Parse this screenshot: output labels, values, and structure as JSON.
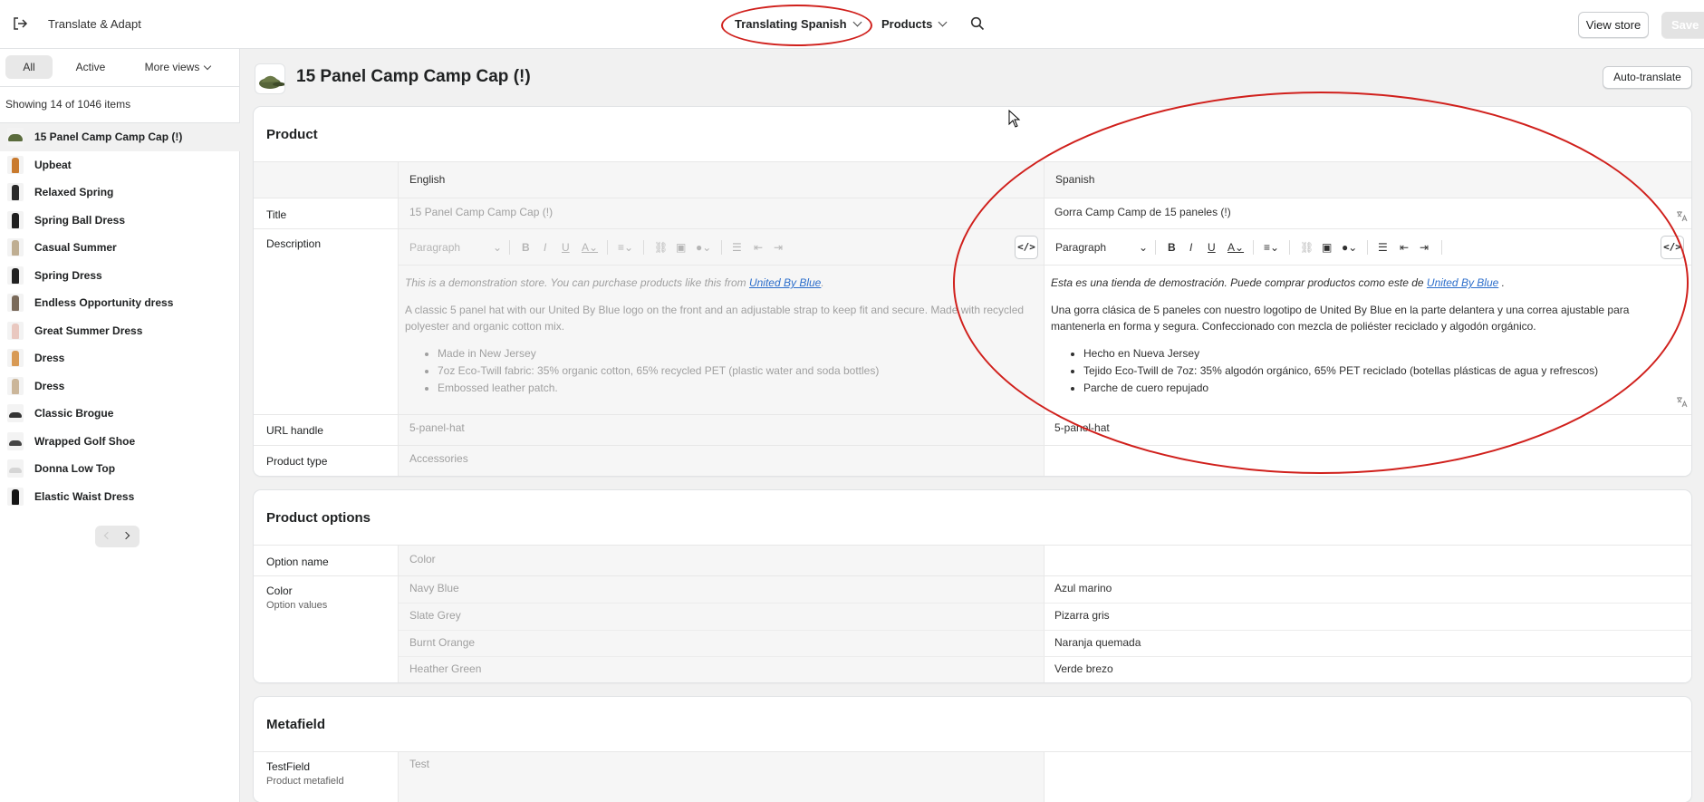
{
  "topbar": {
    "app_title": "Translate & Adapt",
    "language_selector": "Translating Spanish",
    "resource_selector": "Products",
    "view_store": "View store",
    "save": "Save"
  },
  "sidebar": {
    "tabs": [
      "All",
      "Active",
      "More views"
    ],
    "count_text": "Showing 14 of 1046 items",
    "items": [
      {
        "label": "15 Panel Camp Camp Cap (!)",
        "thumb_color": "#5a6b3c"
      },
      {
        "label": "Upbeat",
        "thumb_color": "#c97a2e"
      },
      {
        "label": "Relaxed Spring",
        "thumb_color": "#2a2a2a"
      },
      {
        "label": "Spring Ball Dress",
        "thumb_color": "#1f1f1f"
      },
      {
        "label": "Casual Summer",
        "thumb_color": "#bfae92"
      },
      {
        "label": "Spring Dress",
        "thumb_color": "#222222"
      },
      {
        "label": "Endless Opportunity dress",
        "thumb_color": "#7a6a5a"
      },
      {
        "label": "Great Summer Dress",
        "thumb_color": "#e9c8c0"
      },
      {
        "label": "Dress",
        "thumb_color": "#d89a55"
      },
      {
        "label": "Dress",
        "thumb_color": "#cbb69a"
      },
      {
        "label": "Classic Brogue",
        "thumb_color": "#333333"
      },
      {
        "label": "Wrapped Golf Shoe",
        "thumb_color": "#444444"
      },
      {
        "label": "Donna Low Top",
        "thumb_color": "#d5d5d5"
      },
      {
        "label": "Elastic Waist Dress",
        "thumb_color": "#151515"
      }
    ]
  },
  "main": {
    "product_title": "15 Panel Camp Camp Cap (!)",
    "auto_translate": "Auto-translate",
    "product_card": {
      "title": "Product",
      "col_en": "English",
      "col_es": "Spanish",
      "title_label": "Title",
      "title_en": "15 Panel Camp Camp Cap (!)",
      "title_es": "Gorra Camp Camp de 15 paneles (!)",
      "description_label": "Description",
      "toolbar_paragraph": "Paragraph",
      "desc_en": {
        "intro": "This is a demonstration store. You can purchase products like this from ",
        "link": "United By Blue",
        "intro_end": ".",
        "body": "A classic 5 panel hat with our United By Blue logo on the front and an adjustable strap to keep fit and secure. Made with recycled polyester and organic cotton mix.",
        "bullets": [
          "Made in New Jersey",
          "7oz Eco-Twill fabric: 35% organic cotton, 65% recycled PET (plastic water and soda bottles)",
          "Embossed leather patch."
        ]
      },
      "desc_es": {
        "intro": "Esta es una tienda de demostración. Puede comprar productos como este de ",
        "link": "United By Blue",
        "intro_end": " .",
        "body": "Una gorra clásica de 5 paneles con nuestro logotipo de United By Blue en la parte delantera y una correa ajustable para mantenerla en forma y segura. Confeccionado con mezcla de poliéster reciclado y algodón orgánico.",
        "bullets": [
          "Hecho en Nueva Jersey",
          "Tejido Eco-Twill de 7oz: 35% algodón orgánico, 65% PET reciclado (botellas plásticas de agua y refrescos)",
          "Parche de cuero repujado"
        ]
      },
      "url_label": "URL handle",
      "url_en": "5-panel-hat",
      "url_es": "5-panel-hat",
      "type_label": "Product type",
      "type_en": "Accessories",
      "type_es": ""
    },
    "options_card": {
      "title": "Product options",
      "option_name_label": "Option name",
      "option_name_en": "Color",
      "option_name_es": "",
      "color_label": "Color",
      "color_sublabel": "Option values",
      "values": [
        {
          "en": "Navy Blue",
          "es": "Azul marino"
        },
        {
          "en": "Slate Grey",
          "es": "Pizarra gris"
        },
        {
          "en": "Burnt Orange",
          "es": "Naranja quemada"
        },
        {
          "en": "Heather Green",
          "es": "Verde brezo"
        }
      ]
    },
    "metafield_card": {
      "title": "Metafield",
      "field_label": "TestField",
      "field_sublabel": "Product metafield",
      "field_en": "Test",
      "field_es": ""
    }
  },
  "colors": {
    "annotation_red": "#d0201c",
    "link_blue": "#2c6ecb"
  }
}
